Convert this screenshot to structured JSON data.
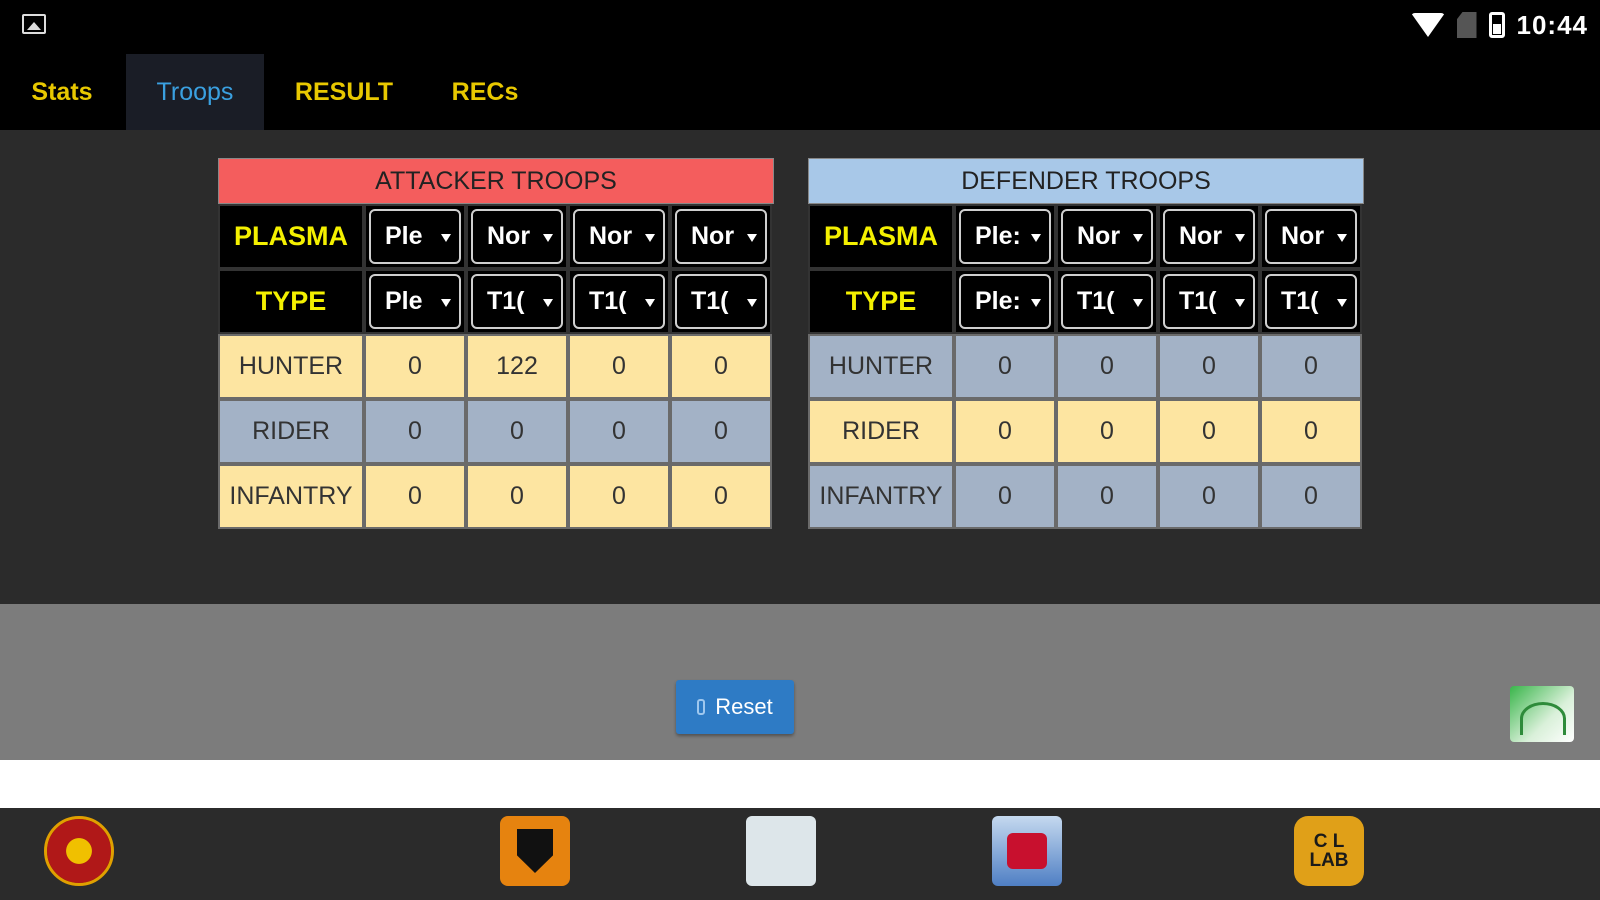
{
  "status_bar": {
    "time": "10:44"
  },
  "tabs": [
    {
      "label": "Stats",
      "active": false
    },
    {
      "label": "Troops",
      "active": true
    },
    {
      "label": "RESULT",
      "active": false
    },
    {
      "label": "RECs",
      "active": false
    }
  ],
  "attacker": {
    "title": "ATTACKER TROOPS",
    "header_color": "#f45d5d",
    "plasma_label": "PLASMA",
    "type_label": "TYPE",
    "plasma": [
      "Ple",
      "Nor",
      "Nor",
      "Nor"
    ],
    "type": [
      "Ple",
      "T1(",
      "T1(",
      "T1("
    ],
    "rows": [
      {
        "label": "HUNTER",
        "values": [
          "0",
          "122",
          "0",
          "0"
        ]
      },
      {
        "label": "RIDER",
        "values": [
          "0",
          "0",
          "0",
          "0"
        ]
      },
      {
        "label": "INFANTRY",
        "values": [
          "0",
          "0",
          "0",
          "0"
        ]
      }
    ]
  },
  "defender": {
    "title": "DEFENDER TROOPS",
    "header_color": "#a8c8e8",
    "plasma_label": "PLASMA",
    "type_label": "TYPE",
    "plasma": [
      "Ple:",
      "Nor",
      "Nor",
      "Nor"
    ],
    "type": [
      "Ple:",
      "T1(",
      "T1(",
      "T1("
    ],
    "rows": [
      {
        "label": "HUNTER",
        "values": [
          "0",
          "0",
          "0",
          "0"
        ]
      },
      {
        "label": "RIDER",
        "values": [
          "0",
          "0",
          "0",
          "0"
        ]
      },
      {
        "label": "INFANTRY",
        "values": [
          "0",
          "0",
          "0",
          "0"
        ]
      }
    ]
  },
  "actions": {
    "reset_label": "Reset"
  },
  "dock": [
    {
      "icon": "guild-emblem-icon"
    },
    {
      "icon": "knight-shield-icon"
    },
    {
      "icon": "data-app-icon"
    },
    {
      "icon": "tractor-app-icon"
    },
    {
      "icon": "col-lab-icon",
      "text": "C L LAB"
    }
  ],
  "colors": {
    "tab_active": "#3aa0e0",
    "tab_inactive": "#e8c800",
    "row_yellow": "#fde5a1",
    "row_grey": "#a3b2c6",
    "label_text": "#f4f000",
    "reset_button": "#2e7bc5"
  }
}
